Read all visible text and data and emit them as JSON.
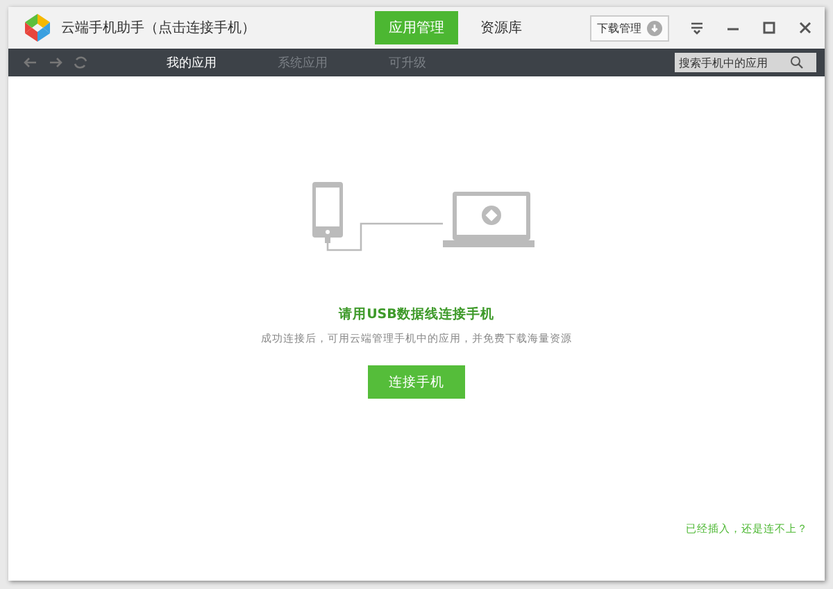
{
  "window": {
    "title": "云端手机助手（点击连接手机）"
  },
  "top_tabs": [
    {
      "label": "应用管理",
      "selected": true
    },
    {
      "label": "资源库",
      "selected": false
    }
  ],
  "download_button": {
    "label": "下载管理"
  },
  "nav_tabs": [
    {
      "label": "我的应用",
      "selected": true
    },
    {
      "label": "系统应用",
      "selected": false
    },
    {
      "label": "可升级",
      "selected": false
    }
  ],
  "search": {
    "placeholder": "搜索手机中的应用"
  },
  "connect_panel": {
    "heading": "请用USB数据线连接手机",
    "description": "成功连接后，可用云端管理手机中的应用，并免费下载海量资源",
    "button": "连接手机"
  },
  "help_link": "已经插入，还是连不上？"
}
